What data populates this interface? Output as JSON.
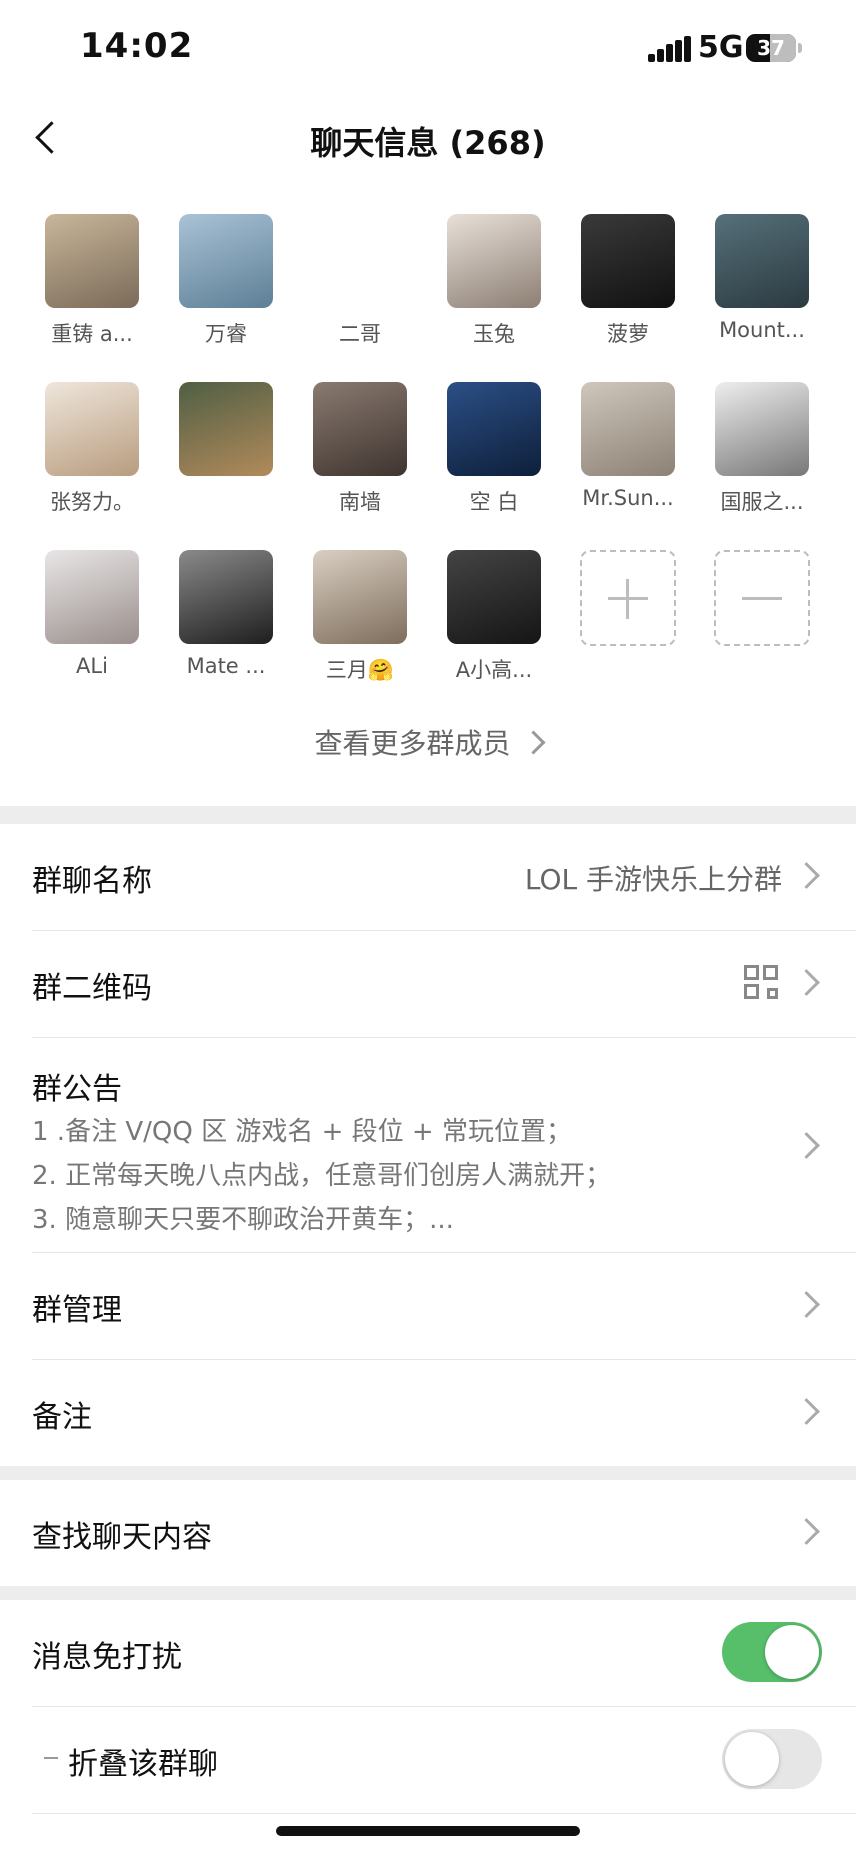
{
  "status": {
    "time": "14:02",
    "network": "5G",
    "battery": "37"
  },
  "nav": {
    "title": "聊天信息 (268)"
  },
  "members": [
    {
      "name": "重铸 a...",
      "colors": [
        "#c9b69a",
        "#7a6a58"
      ]
    },
    {
      "name": "万睿",
      "colors": [
        "#a9c2d6",
        "#5d7f96"
      ]
    },
    {
      "name": "二哥",
      "colors": [
        "#ffffff",
        "#ffffff"
      ]
    },
    {
      "name": "玉兔",
      "colors": [
        "#e8e0d8",
        "#8c7f74"
      ]
    },
    {
      "name": "菠萝",
      "colors": [
        "#3a3a3a",
        "#111111"
      ]
    },
    {
      "name": "Mount...",
      "colors": [
        "#56707a",
        "#2b3a40"
      ]
    },
    {
      "name": "张努力。",
      "colors": [
        "#efe6dc",
        "#b89c7e"
      ]
    },
    {
      "name": "",
      "colors": [
        "#4f5f44",
        "#b28a5b"
      ]
    },
    {
      "name": "南墙",
      "colors": [
        "#8a7a70",
        "#3e342f"
      ]
    },
    {
      "name": "空  白",
      "colors": [
        "#2b4f86",
        "#0e1f3a"
      ]
    },
    {
      "name": "Mr.Sun...",
      "colors": [
        "#cfc7bc",
        "#8c8175"
      ]
    },
    {
      "name": "国服之...",
      "colors": [
        "#eeeeee",
        "#777777"
      ]
    },
    {
      "name": "ALi",
      "colors": [
        "#e8e6e6",
        "#9a8f8c"
      ]
    },
    {
      "name": "Mate ...",
      "colors": [
        "#8a8a8a",
        "#1e1e1e"
      ]
    },
    {
      "name": "三月🤗",
      "colors": [
        "#d9cfc2",
        "#7e6d5c"
      ]
    },
    {
      "name": "A小高...",
      "colors": [
        "#444444",
        "#151515"
      ]
    }
  ],
  "more_members": "查看更多群成员",
  "rows": {
    "group_name_label": "群聊名称",
    "group_name_value": "LOL 手游快乐上分群",
    "qr_label": "群二维码",
    "announcement_label": "群公告",
    "announcement_lines": [
      "1 .备注 V/QQ 区 游戏名 + 段位 + 常玩位置；",
      "2. 正常每天晚八点内战，任意哥们创房人满就开；",
      "3. 随意聊天只要不聊政治开黄车；..."
    ],
    "manage_label": "群管理",
    "remark_label": "备注",
    "search_label": "查找聊天内容",
    "mute_label": "消息免打扰",
    "fold_label": "折叠该群聊",
    "mute_on": true,
    "fold_on": false
  },
  "colors": {
    "toggle_on": "#57be6a",
    "background": "#ededed"
  }
}
